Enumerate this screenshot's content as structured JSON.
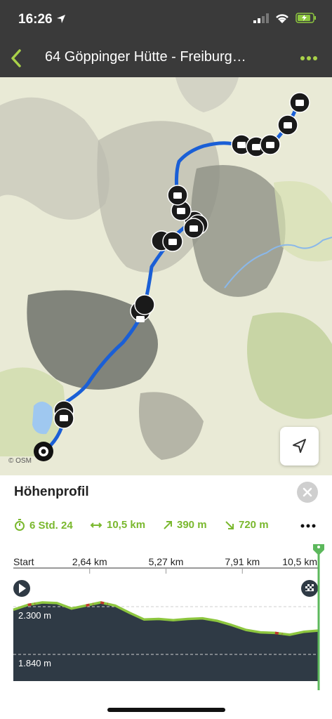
{
  "status_bar": {
    "time": "16:26"
  },
  "header": {
    "title": "64 Göppinger Hütte - Freiburg…"
  },
  "map": {
    "attribution": "© OSM"
  },
  "panel": {
    "title": "Höhenprofil",
    "stats": {
      "duration": "6 Std. 24",
      "distance": "10,5 km",
      "ascent": "390 m",
      "descent": "720 m"
    }
  },
  "chart_data": {
    "type": "area",
    "xlabel": "",
    "ylabel": "",
    "x_tick_labels": [
      "Start",
      "2,64 km",
      "5,27 km",
      "7,91 km",
      "10,5 km"
    ],
    "y_tick_labels": [
      "2.300 m",
      "1.840 m"
    ],
    "x": [
      0,
      0.5,
      1.0,
      1.5,
      2.0,
      2.5,
      3.0,
      3.5,
      4.0,
      4.5,
      5.0,
      5.5,
      6.0,
      6.5,
      7.0,
      7.5,
      8.0,
      8.5,
      9.0,
      9.5,
      10.0,
      10.5
    ],
    "values": [
      2285,
      2325,
      2345,
      2340,
      2295,
      2320,
      2345,
      2320,
      2260,
      2205,
      2210,
      2200,
      2210,
      2215,
      2195,
      2160,
      2120,
      2100,
      2095,
      2080,
      2105,
      2115
    ],
    "xlim": [
      0,
      10.5
    ],
    "ylim": [
      1700,
      2420
    ],
    "colors": {
      "area": "#2f3a45",
      "line": "#8dc63f",
      "steep": "#c0392b",
      "marker": "#5cb85c"
    }
  },
  "colors": {
    "accent": "#8dc63f",
    "route": "#1a5fd6",
    "header_bg": "#3a3a3a"
  }
}
